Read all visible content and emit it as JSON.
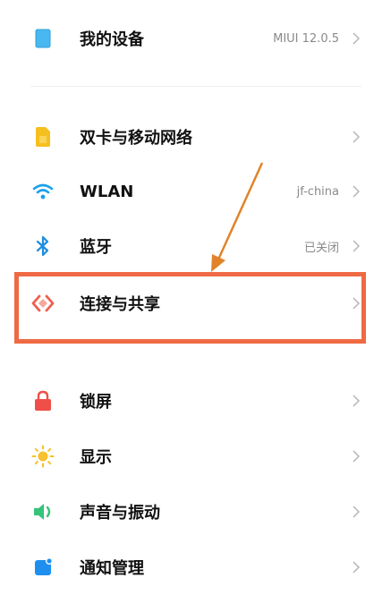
{
  "settings": {
    "device": {
      "label": "我的设备",
      "value": "MIUI 12.0.5",
      "icon": "device-icon"
    },
    "sim": {
      "label": "双卡与移动网络",
      "icon": "sim-card-icon"
    },
    "wlan": {
      "label": "WLAN",
      "value": "jf-china",
      "icon": "wifi-icon"
    },
    "bluetooth": {
      "label": "蓝牙",
      "value": "已关闭",
      "icon": "bluetooth-icon"
    },
    "connection": {
      "label": "连接与共享",
      "icon": "connection-share-icon"
    },
    "lock": {
      "label": "锁屏",
      "icon": "lock-icon"
    },
    "display": {
      "label": "显示",
      "icon": "sun-icon"
    },
    "sound": {
      "label": "声音与振动",
      "icon": "speaker-icon"
    },
    "notifications": {
      "label": "通知管理",
      "icon": "notification-icon"
    }
  },
  "colors": {
    "highlight": "#ef6a44",
    "arrow": "#e0832a",
    "device": "#49b8f0",
    "sim": "#f5bf1e",
    "wifi": "#1aa0ec",
    "bluetooth": "#1e8de0",
    "connection": "#ef5f4e",
    "lock": "#ef4f48",
    "sun": "#f6c12c",
    "speaker": "#37c37a",
    "notification": "#1e8fef"
  }
}
